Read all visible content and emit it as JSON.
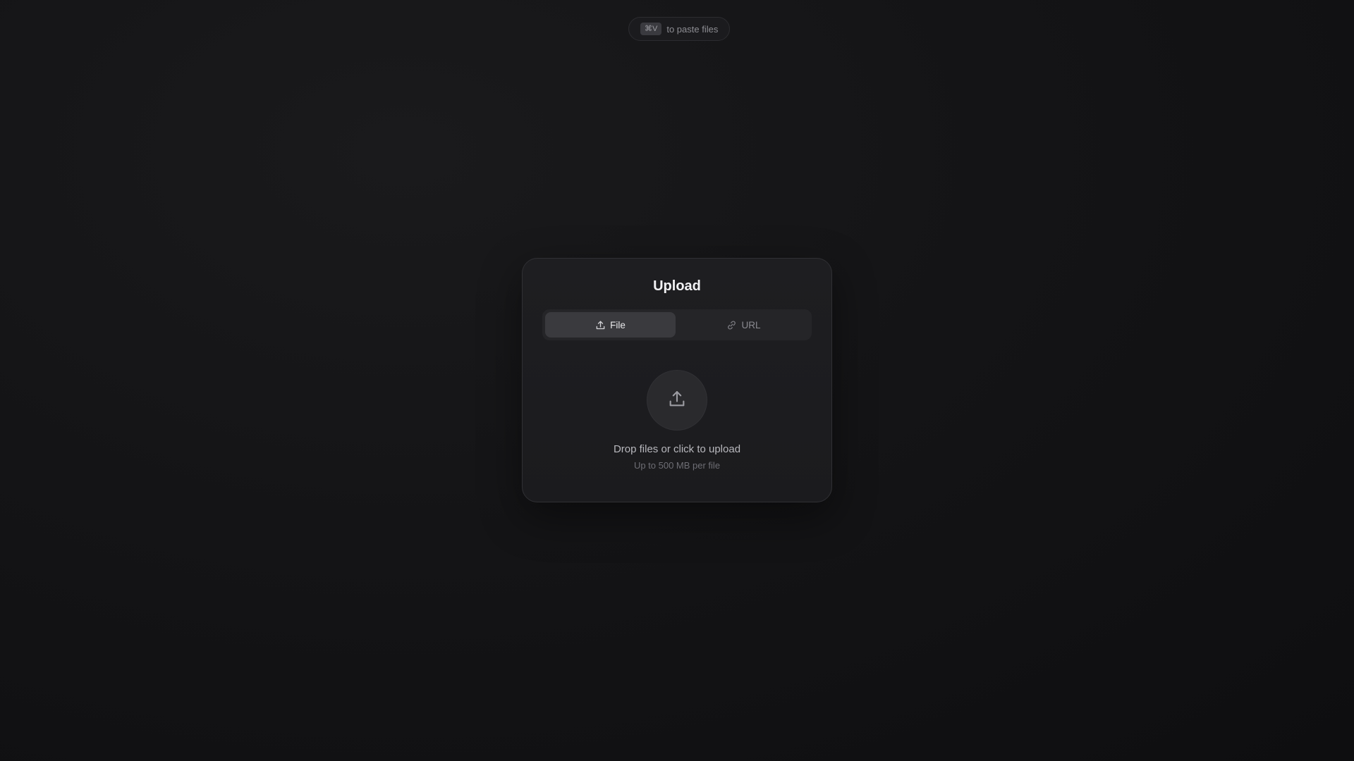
{
  "paste_hint": {
    "shortcut": "⌘V",
    "text": "to paste files"
  },
  "upload_card": {
    "title": "Upload",
    "tabs": [
      {
        "label": "File",
        "icon": "upload-icon",
        "active": true
      },
      {
        "label": "URL",
        "icon": "link-icon",
        "active": false
      }
    ],
    "dropzone": {
      "icon": "upload-icon",
      "primary_text": "Drop files or click to upload",
      "secondary_text": "Up to 500 MB per file"
    }
  }
}
